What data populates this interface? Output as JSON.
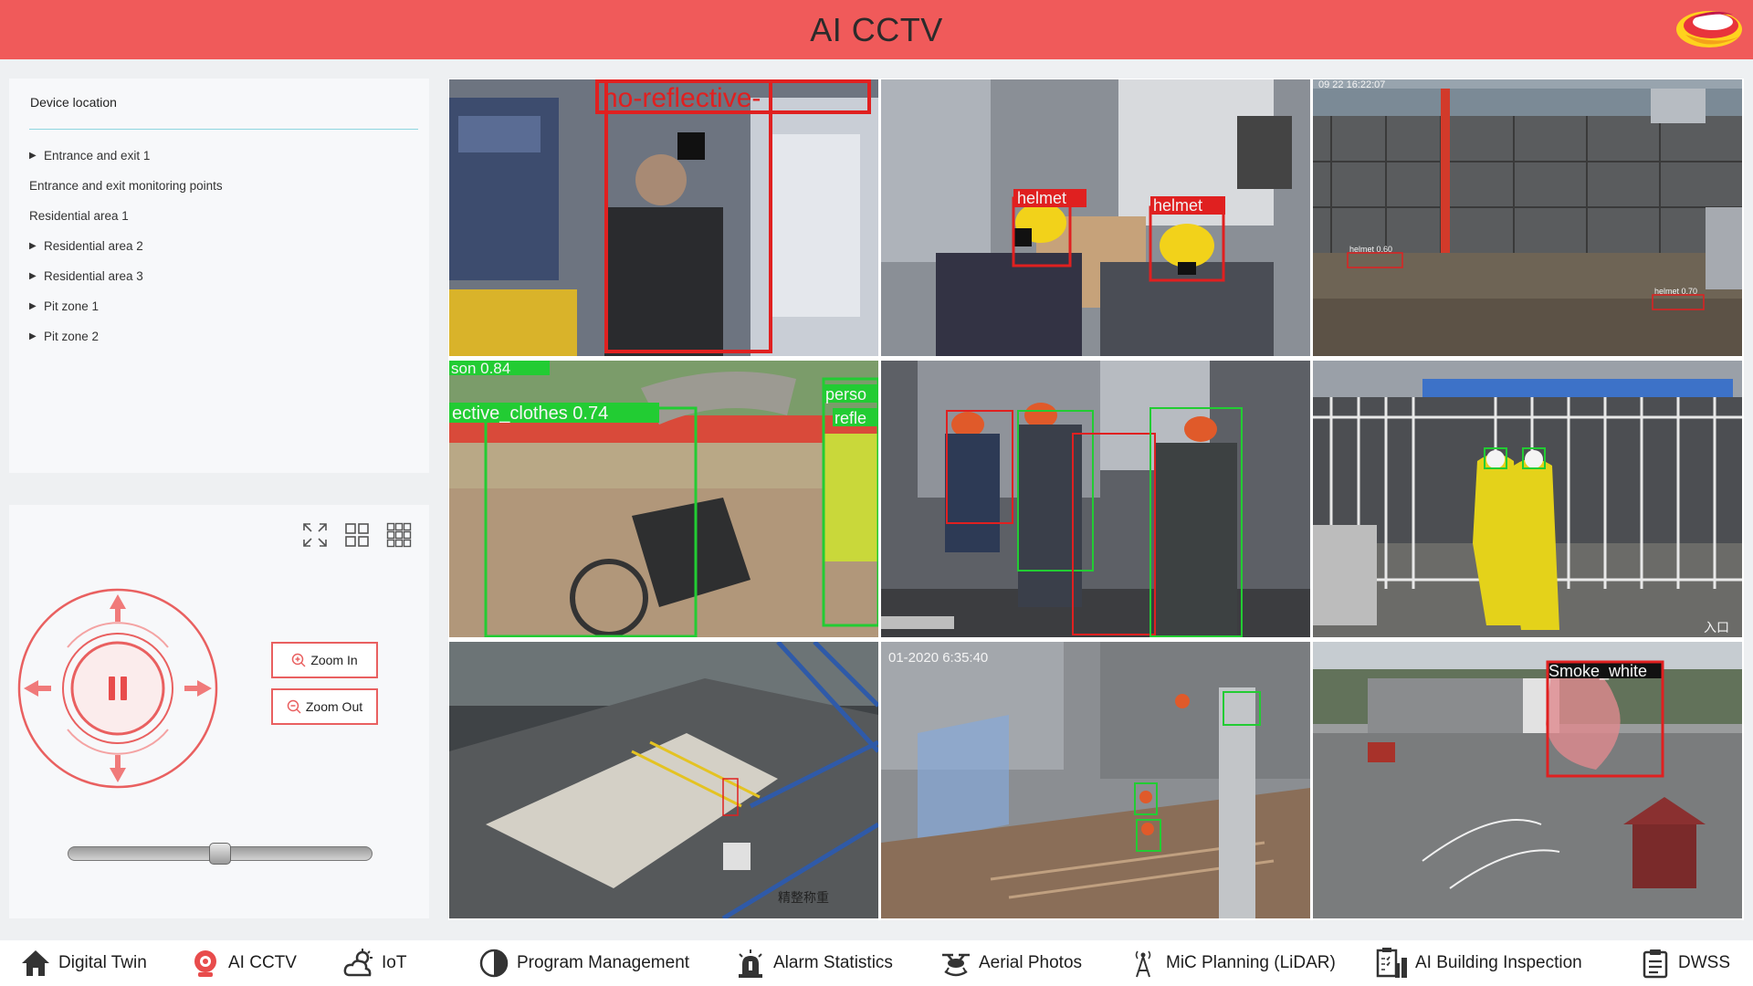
{
  "header": {
    "title": "AI CCTV"
  },
  "device_panel": {
    "title": "Device location",
    "items": [
      {
        "label": "Entrance and exit 1",
        "expandable": true
      },
      {
        "label": "Entrance and exit monitoring points",
        "expandable": false
      },
      {
        "label": "Residential area 1",
        "expandable": false
      },
      {
        "label": "Residential area 2",
        "expandable": true
      },
      {
        "label": "Residential area 3",
        "expandable": true
      },
      {
        "label": "Pit zone 1",
        "expandable": true
      },
      {
        "label": "Pit zone 2",
        "expandable": true
      }
    ]
  },
  "controls": {
    "zoom_in": "Zoom In",
    "zoom_out": "Zoom Out",
    "slider_value": 0.5,
    "layout_icons": [
      "fullscreen-icon",
      "grid-2x2-icon",
      "grid-3x3-icon"
    ]
  },
  "cameras": [
    {
      "labels": [
        "no-reflective-"
      ]
    },
    {
      "labels": [
        "helmet",
        "helmet"
      ]
    },
    {
      "labels": [
        "helmet 0.60",
        "helmet 0.70"
      ],
      "overlay": "09 22 16:22:07"
    },
    {
      "labels": [
        "son 0.84",
        "ective_clothes 0.74",
        "perso",
        "refle"
      ]
    },
    {
      "labels": []
    },
    {
      "labels": [],
      "overlay": "入口"
    },
    {
      "labels": [],
      "overlay": "精整称重"
    },
    {
      "labels": [],
      "overlay": "01-2020 6:35:40"
    },
    {
      "labels": [
        "Smoke_white"
      ]
    }
  ],
  "nav": {
    "items": [
      {
        "label": "Digital Twin",
        "icon": "home-icon"
      },
      {
        "label": "AI CCTV",
        "icon": "camera-icon"
      },
      {
        "label": "IoT",
        "icon": "cloud-sun-icon"
      },
      {
        "label": "Program Management",
        "icon": "pie-chart-icon"
      },
      {
        "label": "Alarm Statistics",
        "icon": "alarm-icon"
      },
      {
        "label": "Aerial Photos",
        "icon": "drone-icon"
      },
      {
        "label": "MiC Planning (LiDAR)",
        "icon": "signal-tower-icon"
      },
      {
        "label": "AI Building Inspection",
        "icon": "building-inspection-icon"
      },
      {
        "label": "DWSS",
        "icon": "clipboard-icon"
      }
    ]
  },
  "colors": {
    "header": "#f05a5a",
    "accent": "#e96060",
    "divider": "#8fd6df",
    "detect_red": "#e02020",
    "detect_green": "#22cc33"
  }
}
